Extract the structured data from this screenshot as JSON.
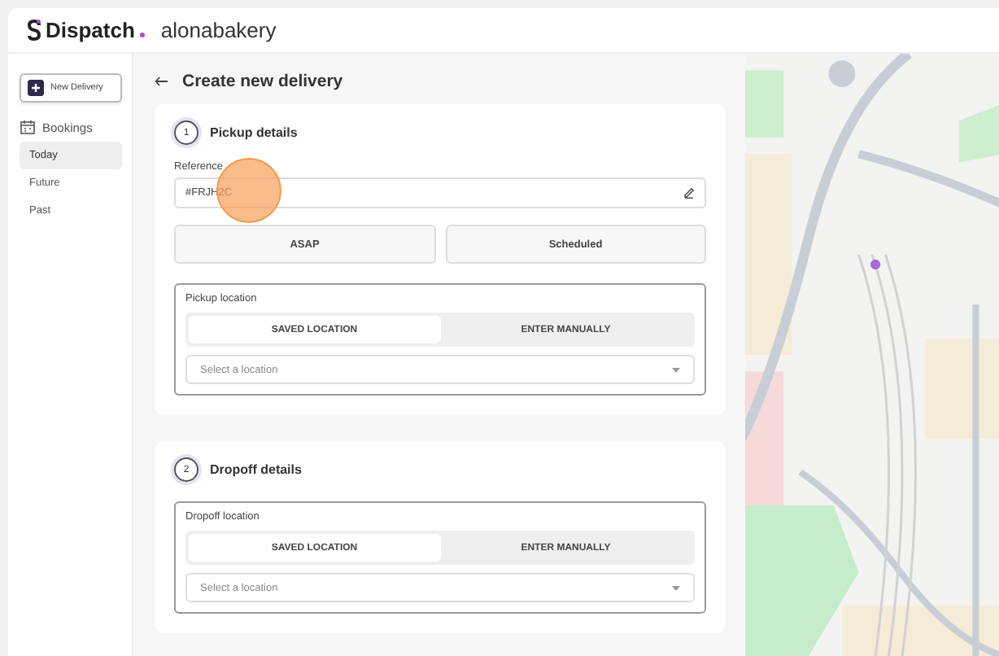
{
  "header": {
    "brand": "Dispatch",
    "account": "alonabakery"
  },
  "sidebar": {
    "new_button": "New Delivery",
    "section": "Bookings",
    "items": [
      {
        "label": "Today",
        "selected": true
      },
      {
        "label": "Future",
        "selected": false
      },
      {
        "label": "Past",
        "selected": false
      }
    ]
  },
  "page_title": "Create new delivery",
  "sections": [
    {
      "step": "1",
      "title": "Pickup details",
      "reference": {
        "label": "Reference",
        "value": "#FRJH2C"
      },
      "timing": [
        "ASAP",
        "Scheduled"
      ],
      "location": {
        "label": "Pickup location",
        "modes": [
          {
            "label": "SAVED LOCATION",
            "selected": true
          },
          {
            "label": "ENTER MANUALLY",
            "selected": false
          }
        ],
        "placeholder": "Select a location"
      }
    },
    {
      "step": "2",
      "title": "Dropoff details",
      "location": {
        "label": "Dropoff location",
        "modes": [
          {
            "label": "SAVED LOCATION",
            "selected": true
          },
          {
            "label": "ENTER MANUALLY",
            "selected": false
          }
        ],
        "placeholder": "Select a location"
      }
    }
  ]
}
